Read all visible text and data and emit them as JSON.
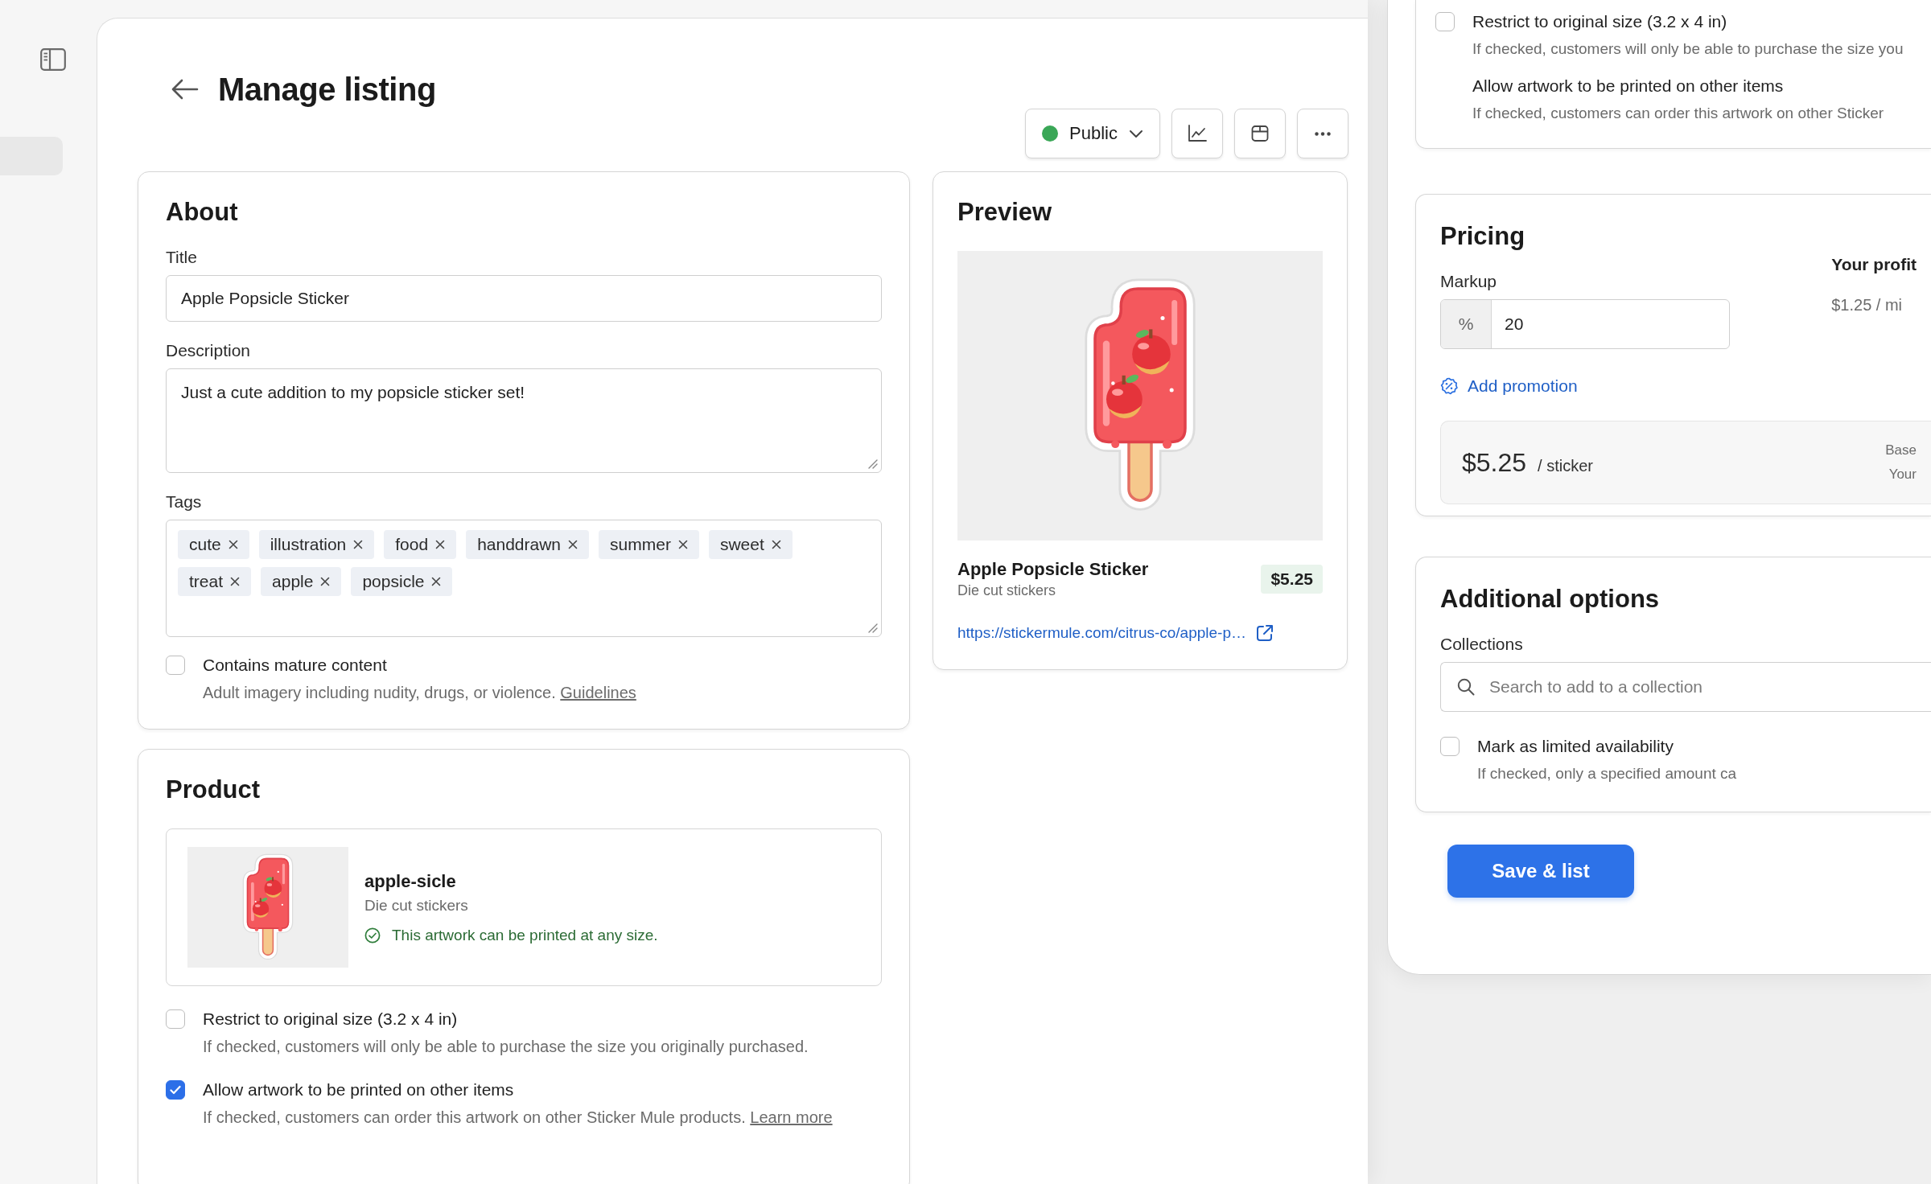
{
  "sidebar": {
    "items": [
      {
        "selected": true
      }
    ]
  },
  "header": {
    "title": "Manage listing",
    "visibility": "Public"
  },
  "about": {
    "heading": "About",
    "title_field": {
      "label": "Title",
      "value": "Apple Popsicle Sticker"
    },
    "description_field": {
      "label": "Description",
      "value": "Just a cute addition to my popsicle sticker set!"
    },
    "tags_field": {
      "label": "Tags",
      "tags": [
        "cute",
        "illustration",
        "food",
        "handdrawn",
        "summer",
        "sweet",
        "treat",
        "apple",
        "popsicle"
      ]
    },
    "mature_content": {
      "label": "Contains mature content",
      "checked": false,
      "help": "Adult imagery including nudity, drugs, or violence.",
      "link": "Guidelines"
    }
  },
  "preview": {
    "heading": "Preview",
    "name": "Apple Popsicle Sticker",
    "type": "Die cut stickers",
    "price": "$5.25",
    "url": "https://stickermule.com/citrus-co/apple-p…"
  },
  "product": {
    "heading": "Product",
    "name": "apple-sicle",
    "type": "Die cut stickers",
    "notice": "This artwork can be printed at any size.",
    "options": [
      {
        "label": "Restrict to original size (3.2 x 4 in)",
        "description": "If checked, customers will only be able to purchase the size you originally purchased.",
        "checked": false
      },
      {
        "label": "Allow artwork to be printed on other items",
        "description": "If checked, customers can order this artwork on other Sticker Mule products.",
        "link": "Learn more",
        "checked": true
      }
    ]
  },
  "right_panel": {
    "product_options": [
      {
        "label": "Restrict to original size (3.2 x 4 in)",
        "description": "If checked, customers will only be able to purchase the size you",
        "checked": false
      },
      {
        "label": "Allow artwork to be printed on other items",
        "description": "If checked, customers can order this artwork on other Sticker"
      }
    ],
    "pricing": {
      "heading": "Pricing",
      "markup": {
        "label": "Markup",
        "unit": "%",
        "value": "20"
      },
      "profit": {
        "label": "Your profit",
        "value": "$1.25 / mi"
      },
      "promotion_link": "Add promotion",
      "total": {
        "price": "$5.25",
        "unit": "/ sticker"
      },
      "breakdown": [
        "Base",
        "Your"
      ]
    },
    "additional_options": {
      "heading": "Additional options",
      "collections": {
        "label": "Collections",
        "placeholder": "Search to add to a collection"
      },
      "limited": {
        "label": "Mark as limited availability",
        "description": "If checked, only a specified amount ca",
        "checked": false
      }
    },
    "save_button": "Save & list"
  }
}
